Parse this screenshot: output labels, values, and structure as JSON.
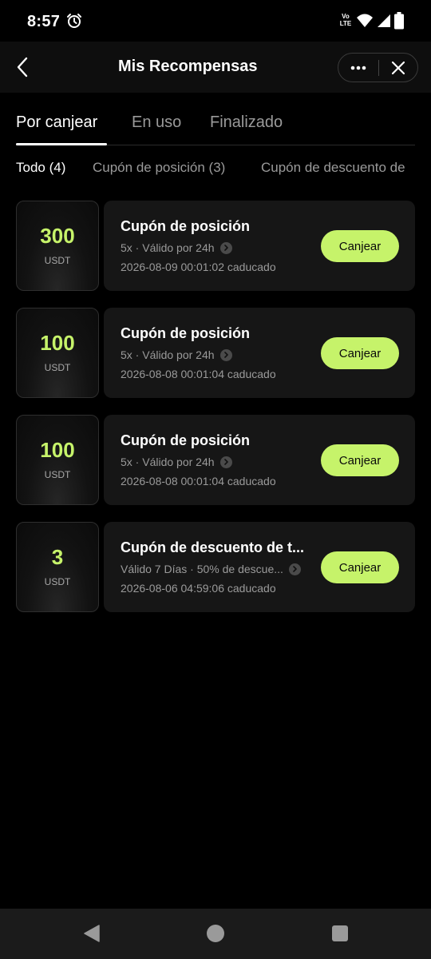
{
  "status_bar": {
    "time": "8:57",
    "volte_top": "Vo",
    "volte_bottom": "LTE",
    "icons": [
      "alarm-icon",
      "volte-icon",
      "wifi-icon",
      "signal-icon",
      "battery-icon"
    ]
  },
  "header": {
    "title": "Mis Recompensas",
    "icons": [
      "back-icon",
      "more-dots-icon",
      "close-icon"
    ]
  },
  "tabs": [
    {
      "label": "Por canjear",
      "active": true
    },
    {
      "label": "En uso",
      "active": false
    },
    {
      "label": "Finalizado",
      "active": false
    }
  ],
  "filters": [
    {
      "label": "Todo (4)",
      "active": true
    },
    {
      "label": "Cupón de posición (3)",
      "active": false
    },
    {
      "label": "Cupón de descuento de",
      "active": false
    }
  ],
  "coupons": [
    {
      "amount": "300",
      "currency": "USDT",
      "title": "Cupón de posición",
      "terms": "5x · Válido por 24h",
      "expiry": "2026-08-09 00:01:02 caducado",
      "action": "Canjear"
    },
    {
      "amount": "100",
      "currency": "USDT",
      "title": "Cupón de posición",
      "terms": "5x · Válido por 24h",
      "expiry": "2026-08-08 00:01:04 caducado",
      "action": "Canjear"
    },
    {
      "amount": "100",
      "currency": "USDT",
      "title": "Cupón de posición",
      "terms": "5x · Válido por 24h",
      "expiry": "2026-08-08 00:01:04 caducado",
      "action": "Canjear"
    },
    {
      "amount": "3",
      "currency": "USDT",
      "title": "Cupón de descuento de t...",
      "terms": "Válido 7 Días · 50% de descue...",
      "expiry": "2026-08-06 04:59:06 caducado",
      "action": "Canjear"
    }
  ],
  "colors": {
    "accent": "#c6f36a",
    "background": "#000000",
    "card": "#161616",
    "muted_text": "#9a9a9a"
  },
  "nav_bar": {
    "icons": [
      "nav-back-icon",
      "nav-home-icon",
      "nav-recents-icon"
    ]
  }
}
